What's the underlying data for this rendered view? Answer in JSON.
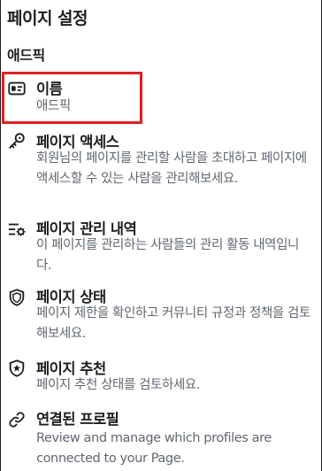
{
  "header": {
    "title": "페이지 설정"
  },
  "page_name": "애드픽",
  "items": [
    {
      "label": "이름",
      "description": "애드픽",
      "icon": "id-card-icon"
    },
    {
      "label": "페이지 액세스",
      "description": "회원님의 페이지를 관리할 사람을 초대하고 페이지에 액세스할 수 있는 사람을 관리해보세요.",
      "icon": "key-icon"
    },
    {
      "label": "페이지 관리 내역",
      "description": "이 페이지를 관리하는 사람들의 관리 활동 내역입니다.",
      "icon": "list-settings-icon"
    },
    {
      "label": "페이지 상태",
      "description": "페이지 제한을 확인하고 커뮤니티 규정과 정책을 검토해보세요.",
      "icon": "shield-icon"
    },
    {
      "label": "페이지 추천",
      "description": "페이지 추천 상태를 검토하세요.",
      "icon": "star-shield-icon"
    },
    {
      "label": "연결된 프로필",
      "description": "Review and manage which profiles are connected to your Page.",
      "icon": "link-icon"
    }
  ]
}
